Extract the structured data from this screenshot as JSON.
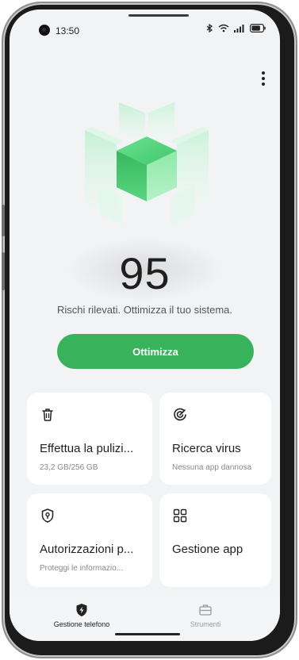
{
  "status": {
    "time": "13:50"
  },
  "score": {
    "value": "95",
    "subtitle": "Rischi rilevati. Ottimizza il tuo sistema."
  },
  "optimize_label": "Ottimizza",
  "cards": [
    {
      "title": "Effettua la pulizi...",
      "subtitle": "23,2 GB/256 GB",
      "icon": "trash-icon"
    },
    {
      "title": "Ricerca virus",
      "subtitle": "Nessuna app dannosa",
      "icon": "virus-scan-icon"
    },
    {
      "title": "Autorizzazioni p...",
      "subtitle": "Proteggi le informazio...",
      "icon": "privacy-shield-icon"
    },
    {
      "title": "Gestione app",
      "icon": "app-grid-icon"
    }
  ],
  "nav": [
    {
      "label": "Gestione telefono",
      "icon": "phone-manager-icon",
      "active": true
    },
    {
      "label": "Strumenti",
      "icon": "toolbox-icon",
      "active": false
    }
  ],
  "colors": {
    "accent": "#38b35b",
    "background": "#f2f3f5",
    "card": "#ffffff"
  }
}
